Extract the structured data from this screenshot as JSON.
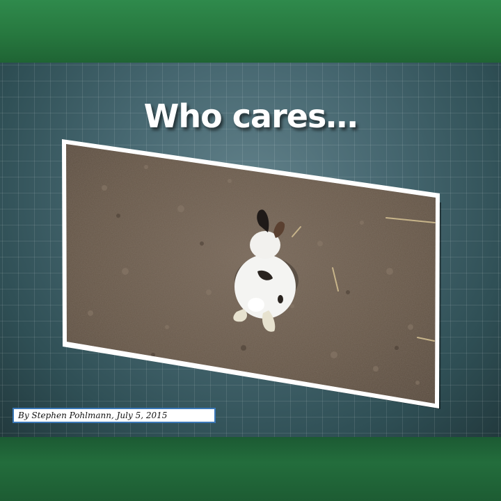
{
  "slide": {
    "title": "Who cares…",
    "caption": "By Stephen Pohlmann, July 5, 2015",
    "photo": {
      "subject": "rabbit-on-soil"
    }
  },
  "colors": {
    "band_green": "#27783f",
    "background_teal": "#466770",
    "caption_border": "#3a78b8",
    "soil": "#6d5e50"
  }
}
